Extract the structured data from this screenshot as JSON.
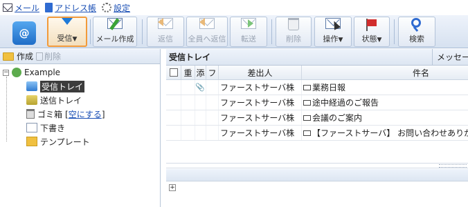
{
  "nav": {
    "mail": "メール",
    "address_book": "アドレス帳",
    "settings": "設定"
  },
  "toolbar": {
    "inbox_receive": "受信",
    "compose": "メール作成",
    "reply": "返信",
    "reply_all": "全員へ返信",
    "forward": "転送",
    "delete": "削除",
    "operation": "操作",
    "status": "状態",
    "search": "検索",
    "logo_text": "@"
  },
  "left": {
    "create": "作成",
    "delete": "削除",
    "account": "Example",
    "folders": [
      {
        "label": "受信トレイ",
        "icon": "inbox-icon"
      },
      {
        "label": "送信トレイ",
        "icon": "outbox-icon"
      },
      {
        "label": "ゴミ箱",
        "icon": "trash-icon",
        "action": "空にする"
      },
      {
        "label": "下書き",
        "icon": "draft-icon"
      },
      {
        "label": "テンプレート",
        "icon": "template-icon"
      }
    ]
  },
  "right": {
    "title": "受信トレイ",
    "tab": "メッセー",
    "columns": {
      "importance": "重",
      "attachment": "添",
      "flag": "フ",
      "from": "差出人",
      "subject": "件名"
    },
    "rows": [
      {
        "from": "ファーストサーバ株",
        "subject": "業務日報",
        "attach": "📎"
      },
      {
        "from": "ファーストサーバ株",
        "subject": "途中経過のご報告",
        "attach": ""
      },
      {
        "from": "ファーストサーバ株",
        "subject": "会議のご案内",
        "attach": ""
      },
      {
        "from": "ファーストサーバ株",
        "subject": "【ファーストサーバ】 お問い合わせありがと",
        "attach": ""
      }
    ]
  }
}
